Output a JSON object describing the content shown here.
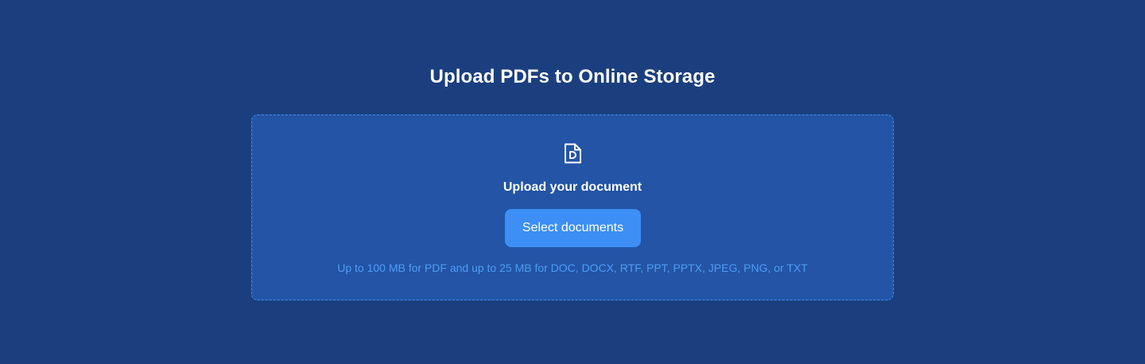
{
  "page": {
    "title": "Upload PDFs to Online Storage"
  },
  "dropzone": {
    "icon": "document-icon",
    "heading": "Upload your document",
    "button_label": "Select documents",
    "limits": "Up to 100 MB for PDF and up to 25 MB for DOC, DOCX, RTF, PPT, PPTX, JPEG, PNG, or TXT"
  },
  "colors": {
    "background": "#1b3f7e",
    "dropzone_background": "#2354a6",
    "dropzone_border": "#3c8df0",
    "button": "#3d8ff5",
    "limits_text": "#4f9cf2"
  }
}
